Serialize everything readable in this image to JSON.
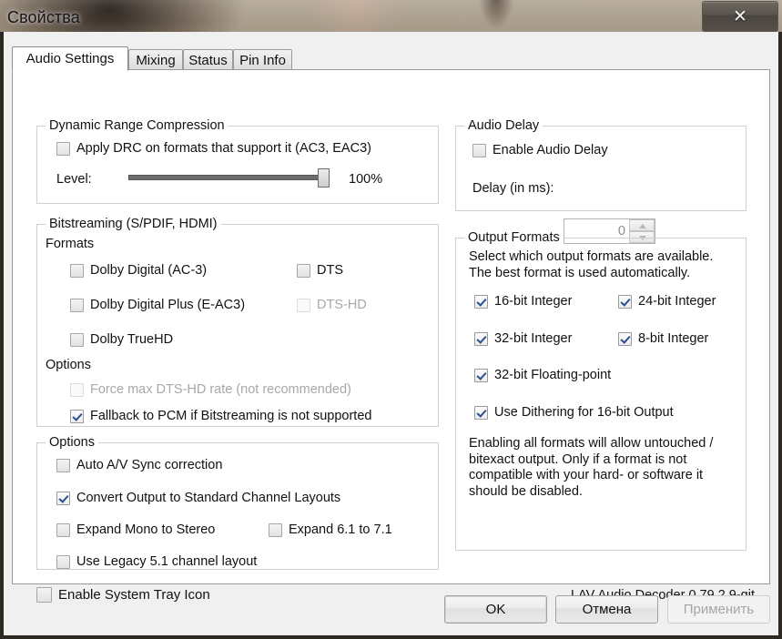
{
  "window": {
    "title": "Свойства",
    "close_label": "✕"
  },
  "tabs": [
    {
      "label": "Audio Settings",
      "active": true
    },
    {
      "label": "Mixing",
      "active": false
    },
    {
      "label": "Status",
      "active": false
    },
    {
      "label": "Pin Info",
      "active": false
    }
  ],
  "dynamic_range": {
    "group_title": "Dynamic Range Compression",
    "apply_drc": {
      "label": "Apply DRC on formats that support it (AC3, EAC3)",
      "checked": false
    },
    "level_label": "Level:",
    "level_value": "100%",
    "level_percent": 100
  },
  "bitstreaming": {
    "group_title": "Bitstreaming (S/PDIF, HDMI)",
    "formats_label": "Formats",
    "options_label": "Options",
    "formats": [
      {
        "label": "Dolby Digital (AC-3)",
        "checked": false,
        "disabled": false
      },
      {
        "label": "DTS",
        "checked": false,
        "disabled": false
      },
      {
        "label": "Dolby Digital Plus (E-AC3)",
        "checked": false,
        "disabled": false
      },
      {
        "label": "DTS-HD",
        "checked": false,
        "disabled": true
      },
      {
        "label": "Dolby TrueHD",
        "checked": false,
        "disabled": false
      }
    ],
    "options": [
      {
        "label": "Force max DTS-HD rate (not recommended)",
        "checked": false,
        "disabled": true
      },
      {
        "label": "Fallback to PCM if Bitstreaming is not supported",
        "checked": true,
        "disabled": false
      }
    ]
  },
  "options": {
    "group_title": "Options",
    "items": [
      {
        "label": "Auto A/V Sync correction",
        "checked": false
      },
      {
        "label": "Convert Output to Standard Channel Layouts",
        "checked": true
      },
      {
        "label": "Expand Mono to Stereo",
        "checked": false
      },
      {
        "label": "Expand 6.1 to 7.1",
        "checked": false
      },
      {
        "label": "Use Legacy 5.1 channel layout",
        "checked": false
      }
    ]
  },
  "tray": {
    "label": "Enable System Tray Icon",
    "checked": false
  },
  "audio_delay": {
    "group_title": "Audio Delay",
    "enable": {
      "label": "Enable Audio Delay",
      "checked": false
    },
    "delay_label": "Delay (in ms):",
    "delay_value": "0"
  },
  "output_formats": {
    "group_title": "Output Formats",
    "description": "Select which output formats are available. The best format is used automatically.",
    "items": [
      {
        "label": "16-bit Integer",
        "checked": true
      },
      {
        "label": "24-bit Integer",
        "checked": true
      },
      {
        "label": "32-bit Integer",
        "checked": true
      },
      {
        "label": "8-bit Integer",
        "checked": true
      },
      {
        "label": "32-bit Floating-point",
        "checked": true
      },
      {
        "label": "Use Dithering for 16-bit Output",
        "checked": true
      }
    ],
    "footnote": "Enabling all formats will allow untouched / bitexact output. Only if a format is not compatible with your hard- or software it should be disabled."
  },
  "version_text": "LAV Audio Decoder 0.79.2.9-git",
  "buttons": {
    "ok": "OK",
    "cancel": "Отмена",
    "apply": "Применить",
    "apply_disabled": true
  }
}
